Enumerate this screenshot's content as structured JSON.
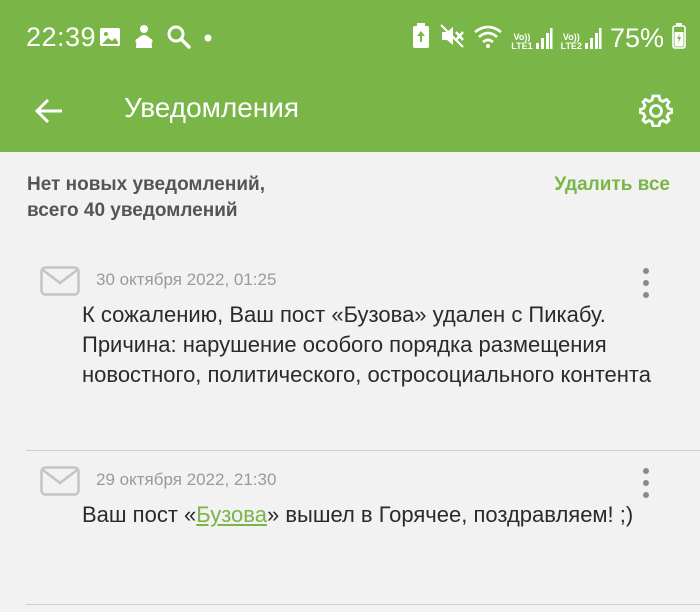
{
  "status_bar": {
    "time": "22:39",
    "battery_percent": "75%",
    "lte1": "LTE1",
    "lte2": "LTE2",
    "volte": "Vo))",
    "left_icons": [
      "gallery-icon",
      "person-icon",
      "search-icon",
      "dot-icon"
    ],
    "right_icons": [
      "battery-saver-icon",
      "mute-icon",
      "wifi-icon",
      "signal-icon",
      "battery-icon"
    ]
  },
  "app_bar": {
    "title": "Уведомления"
  },
  "summary": {
    "line1": "Нет новых уведомлений,",
    "line2": "всего 40 уведомлений",
    "delete_all": "Удалить все"
  },
  "notifications": [
    {
      "date": "30 октября 2022, 01:25",
      "text": "К сожалению, Ваш пост «Бузова» удален с Пикабу. Причина: нарушение особого порядка размещения новостного, политического, остросоциального контента"
    },
    {
      "date": "29 октября 2022, 21:30",
      "text_before": "Ваш пост «",
      "link": "Бузова",
      "text_after": "» вышел в Горячее, поздравляем! ;)"
    }
  ],
  "colors": {
    "accent": "#79b547",
    "background": "#f2f2f2",
    "text": "#2a2a2a",
    "muted": "#9a9a9a"
  }
}
